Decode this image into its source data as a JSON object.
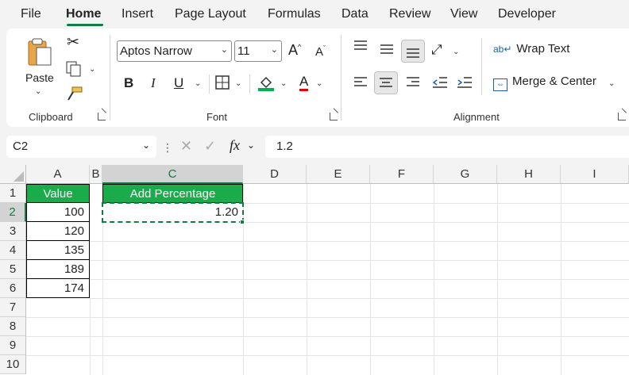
{
  "menu": {
    "items": [
      "File",
      "Home",
      "Insert",
      "Page Layout",
      "Formulas",
      "Data",
      "Review",
      "View",
      "Developer"
    ],
    "active": "Home"
  },
  "ribbon": {
    "clipboard": {
      "paste_label": "Paste",
      "group_label": "Clipboard"
    },
    "font": {
      "font_name": "Aptos Narrow",
      "font_size": "11",
      "group_label": "Font",
      "bold": "B",
      "italic": "I",
      "underline": "U",
      "grow": "A",
      "shrink": "A",
      "font_color_letter": "A",
      "fill_color": "#00b050",
      "font_color": "#e00000"
    },
    "alignment": {
      "wrap_text": "Wrap Text",
      "merge_center": "Merge & Center",
      "group_label": "Alignment"
    }
  },
  "formula_bar": {
    "name_box": "C2",
    "fx": "fx",
    "value": "1.2"
  },
  "grid": {
    "columns": [
      "A",
      "B",
      "C",
      "D",
      "E",
      "F",
      "G",
      "H",
      "I"
    ],
    "rows": [
      "1",
      "2",
      "3",
      "4",
      "5",
      "6",
      "7",
      "8",
      "9",
      "10"
    ],
    "headers": {
      "a1": "Value",
      "c1": "Add Percentage"
    },
    "values": [
      "100",
      "120",
      "135",
      "189",
      "174"
    ],
    "c2": "1.20",
    "selected_cell": "C2",
    "accent": "#107c41",
    "header_fill": "#1aab4b"
  }
}
